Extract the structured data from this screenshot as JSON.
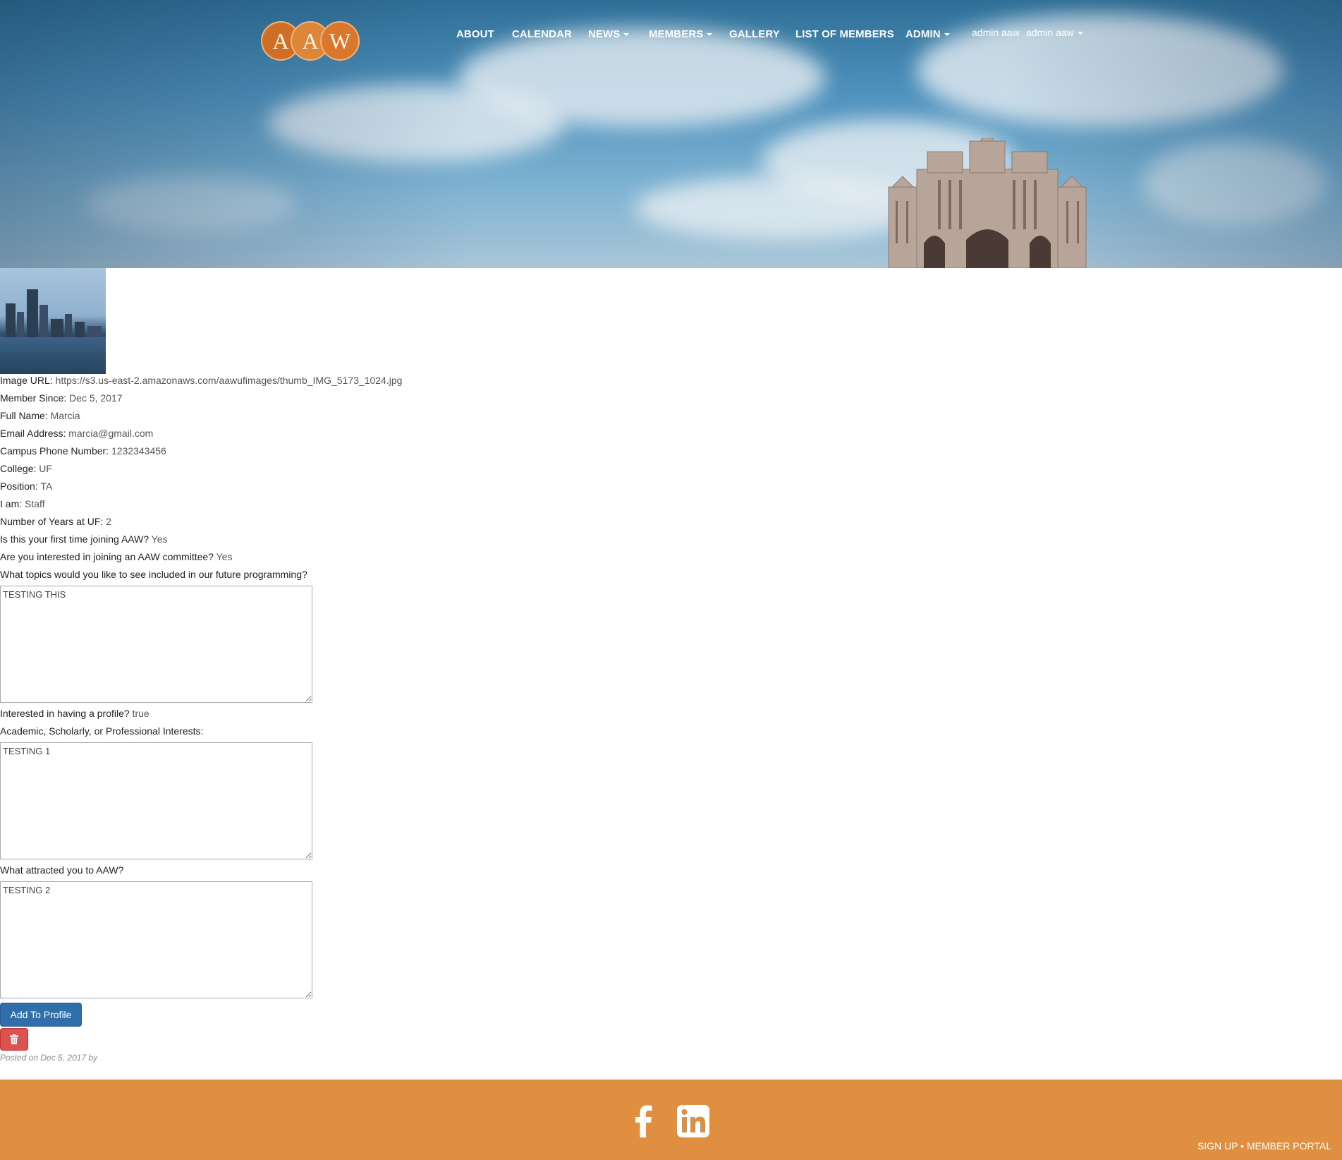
{
  "header": {
    "logo_letters": [
      "A",
      "A",
      "W"
    ],
    "nav": [
      {
        "label": "ABOUT",
        "caret": false
      },
      {
        "label": "CALENDAR",
        "caret": false
      },
      {
        "label": "NEWS",
        "caret": true
      },
      {
        "label": "MEMBERS",
        "caret": true
      },
      {
        "label": "GALLERY",
        "caret": false
      },
      {
        "label": "LIST OF MEMBERS",
        "caret": false
      },
      {
        "label": "ADMIN",
        "caret": true
      }
    ],
    "user": {
      "display_name": "admin aaw",
      "menu_label": "admin aaw"
    }
  },
  "profile": {
    "fields": [
      {
        "label": "Image URL:",
        "value": "https://s3.us-east-2.amazonaws.com/aawufimages/thumb_IMG_5173_1024.jpg"
      },
      {
        "label": "Member Since:",
        "value": "Dec 5, 2017"
      },
      {
        "label": "Full Name:",
        "value": "Marcia"
      },
      {
        "label": "Email Address:",
        "value": "marcia@gmail.com"
      },
      {
        "label": "Campus Phone Number:",
        "value": "1232343456"
      },
      {
        "label": "College:",
        "value": "UF"
      },
      {
        "label": "Position:",
        "value": "TA"
      },
      {
        "label": "I am:",
        "value": "Staff"
      },
      {
        "label": "Number of Years at UF:",
        "value": "2"
      },
      {
        "label": "Is this your first time joining AAW?",
        "value": "Yes"
      },
      {
        "label": "Are you interested in joining an AAW committee?",
        "value": "Yes"
      }
    ],
    "topics_question": "What topics would you like to see included in our future programming?",
    "topics_answer": "TESTING THIS",
    "profile_question": "Interested in having a profile?",
    "profile_answer": "true",
    "interests_question": "Academic, Scholarly, or Professional Interests:",
    "interests_answer": "TESTING 1",
    "attracted_question": "What attracted you to AAW?",
    "attracted_answer": "TESTING 2",
    "add_button_label": "Add To Profile",
    "delete_icon": "trash-icon",
    "posted_text": "Posted on Dec 5, 2017 by"
  },
  "footer": {
    "social_icons": [
      "facebook-icon",
      "linkedin-icon"
    ],
    "signup_label": "SIGN UP",
    "separator": "•",
    "portal_label": "MEMBER PORTAL",
    "color": "#e08e3f"
  },
  "colors": {
    "primary_button": "#2f6eaa",
    "danger_button": "#d9534f",
    "logo_orange": "#d9782c"
  }
}
